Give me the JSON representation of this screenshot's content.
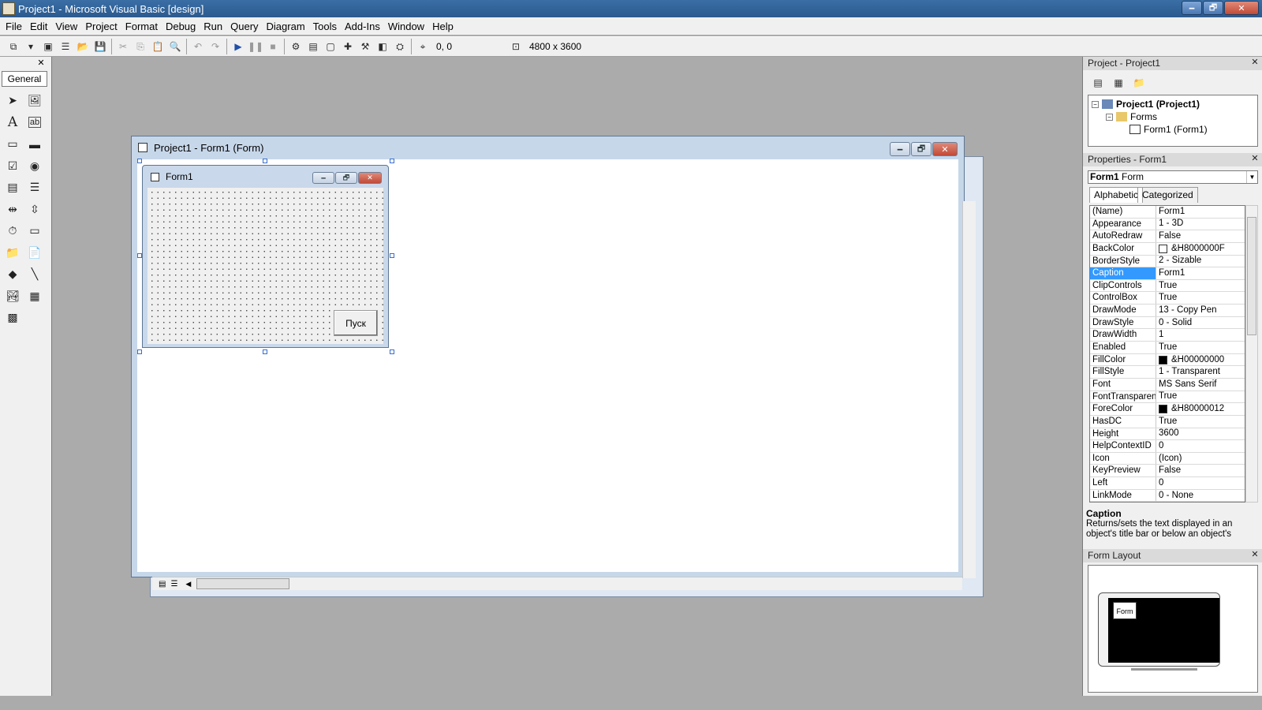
{
  "window": {
    "title": "Project1 - Microsoft Visual Basic [design]",
    "minimize": "🗕",
    "restore": "🗗",
    "close": "✕"
  },
  "menu": [
    "File",
    "Edit",
    "View",
    "Project",
    "Format",
    "Debug",
    "Run",
    "Query",
    "Diagram",
    "Tools",
    "Add-Ins",
    "Window",
    "Help"
  ],
  "toolbar": {
    "position": "0, 0",
    "size": "4800 x 3600"
  },
  "toolbox": {
    "tab_label": "General",
    "close": "✕"
  },
  "designer_window": {
    "title": "Project1 - Form1 (Form)"
  },
  "form1": {
    "caption": "Form1",
    "button_caption": "Пуск"
  },
  "project_pane": {
    "title": "Project - Project1",
    "root": "Project1 (Project1)",
    "folder": "Forms",
    "item": "Form1 (Form1)"
  },
  "properties_pane": {
    "title": "Properties - Form1",
    "object_name": "Form1",
    "object_type": "Form",
    "tab_alphabetic": "Alphabetic",
    "tab_categorized": "Categorized",
    "rows": [
      {
        "name": "(Name)",
        "value": "Form1"
      },
      {
        "name": "Appearance",
        "value": "1 - 3D"
      },
      {
        "name": "AutoRedraw",
        "value": "False"
      },
      {
        "name": "BackColor",
        "value": "&H8000000F",
        "swatch": "#ffffff"
      },
      {
        "name": "BorderStyle",
        "value": "2 - Sizable"
      },
      {
        "name": "Caption",
        "value": "Form1",
        "selected": true
      },
      {
        "name": "ClipControls",
        "value": "True"
      },
      {
        "name": "ControlBox",
        "value": "True"
      },
      {
        "name": "DrawMode",
        "value": "13 - Copy Pen"
      },
      {
        "name": "DrawStyle",
        "value": "0 - Solid"
      },
      {
        "name": "DrawWidth",
        "value": "1"
      },
      {
        "name": "Enabled",
        "value": "True"
      },
      {
        "name": "FillColor",
        "value": "&H00000000",
        "swatch": "#000000"
      },
      {
        "name": "FillStyle",
        "value": "1 - Transparent"
      },
      {
        "name": "Font",
        "value": "MS Sans Serif"
      },
      {
        "name": "FontTransparent",
        "value": "True"
      },
      {
        "name": "ForeColor",
        "value": "&H80000012",
        "swatch": "#000000"
      },
      {
        "name": "HasDC",
        "value": "True"
      },
      {
        "name": "Height",
        "value": "3600"
      },
      {
        "name": "HelpContextID",
        "value": "0"
      },
      {
        "name": "Icon",
        "value": "(Icon)"
      },
      {
        "name": "KeyPreview",
        "value": "False"
      },
      {
        "name": "Left",
        "value": "0"
      },
      {
        "name": "LinkMode",
        "value": "0 - None"
      }
    ],
    "desc_title": "Caption",
    "desc_text": "Returns/sets the text displayed in an object's title bar or below an object's"
  },
  "layout_pane": {
    "title": "Form Layout",
    "mini_form_label": "Form"
  },
  "colors": {
    "titlebar": "#3a6ea5",
    "selection": "#3399ff",
    "mdi_background": "#ababab"
  }
}
